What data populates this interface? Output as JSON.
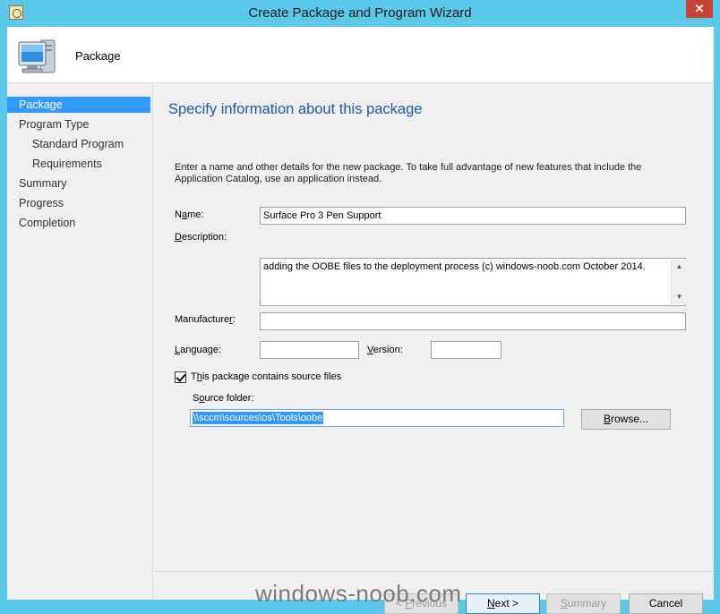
{
  "window": {
    "title": "Create Package and Program Wizard",
    "close_label": "✕"
  },
  "header": {
    "label": "Package"
  },
  "nav": {
    "items": [
      {
        "label": "Package"
      },
      {
        "label": "Program Type"
      },
      {
        "label": "Standard Program"
      },
      {
        "label": "Requirements"
      },
      {
        "label": "Summary"
      },
      {
        "label": "Progress"
      },
      {
        "label": "Completion"
      }
    ]
  },
  "main": {
    "title": "Specify information about this package",
    "intro": "Enter a name and other details for the new package. To take full advantage of new features that include the Application Catalog, use an application instead.",
    "name_label_pre": "N",
    "name_label_ul": "a",
    "name_label_post": "me:",
    "name_value": "Surface Pro 3 Pen Support",
    "desc_label_ul": "D",
    "desc_label_post": "escription:",
    "desc_value": "adding the OOBE files to the deployment process (c) windows-noob.com October 2014.",
    "manuf_label_pre": "Manufacture",
    "manuf_label_ul": "r",
    "manuf_label_post": ":",
    "manuf_value": "",
    "lang_label_ul": "L",
    "lang_label_post": "anguage:",
    "lang_value": "",
    "version_label_ul": "V",
    "version_label_post": "ersion:",
    "version_value": "",
    "source_checkbox_pre": "T",
    "source_checkbox_ul": "h",
    "source_checkbox_post": "is package contains source files",
    "source_folder_pre": "S",
    "source_folder_ul": "o",
    "source_folder_post": "urce folder:",
    "source_folder_value": "\\\\sccm\\sources\\os\\Tools\\oobe",
    "browse_ul": "B",
    "browse_post": "rowse..."
  },
  "footer": {
    "previous_pre": "< ",
    "previous_ul": "P",
    "previous_post": "revious",
    "next_ul": "N",
    "next_post": "ext >",
    "summary_ul": "S",
    "summary_post": "ummary",
    "cancel": "Cancel"
  },
  "watermark": "windows-noob.com",
  "colors": {
    "frame": "#5bc8ea",
    "accent": "#3399ff",
    "title_blue": "#1e5aa8",
    "close_red": "#c7433a"
  }
}
